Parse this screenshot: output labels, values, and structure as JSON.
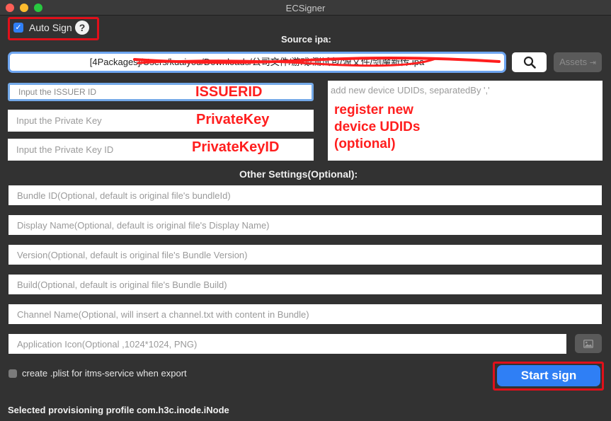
{
  "window": {
    "title": "ECSigner"
  },
  "auto_sign": {
    "label": "Auto Sign",
    "checked": true,
    "help_glyph": "?"
  },
  "source": {
    "title": "Source ipa:",
    "path": "[4Packages]/Users/kuaiyou/Downloads/公司文件/游戏/测试包/源文件/剑魔新传.ipa",
    "search_icon": "magnifier-icon",
    "assets_label": "Assets",
    "assets_icon": "export-icon"
  },
  "credentials": {
    "issuer_placeholder": "Input the ISSUER ID",
    "private_key_placeholder": "Input the Private Key",
    "private_key_id_placeholder": "Input the Private Key ID",
    "udids_placeholder": "add new device UDIDs, separatedBy ','"
  },
  "annotations": {
    "issuer": "ISSUERID",
    "private_key": "PrivateKey",
    "private_key_id": "PrivateKeyID",
    "udids_line1": "register new",
    "udids_line2": "device UDIDs",
    "udids_line3": "(optional)",
    "color": "#ff1e1e"
  },
  "other_settings": {
    "title": "Other Settings(Optional):",
    "bundle_id_placeholder": "Bundle ID(Optional, default is original file's bundleId)",
    "display_name_placeholder": "Display Name(Optional, default is original file's Display Name)",
    "version_placeholder": "Version(Optional, default is original file's Bundle Version)",
    "build_placeholder": "Build(Optional, default is original file's Bundle Build)",
    "channel_placeholder": "Channel Name(Optional, will insert a channel.txt with content in Bundle)",
    "icon_placeholder": "Application Icon(Optional ,1024*1024, PNG)",
    "icon_button_icon": "image-icon"
  },
  "plist": {
    "label": "create .plist for itms-service when export",
    "checked": false
  },
  "start_button": {
    "label": "Start sign",
    "color": "#2f7ff5"
  },
  "status": {
    "text": "Selected provisioning profile com.h3c.inode.iNode"
  }
}
